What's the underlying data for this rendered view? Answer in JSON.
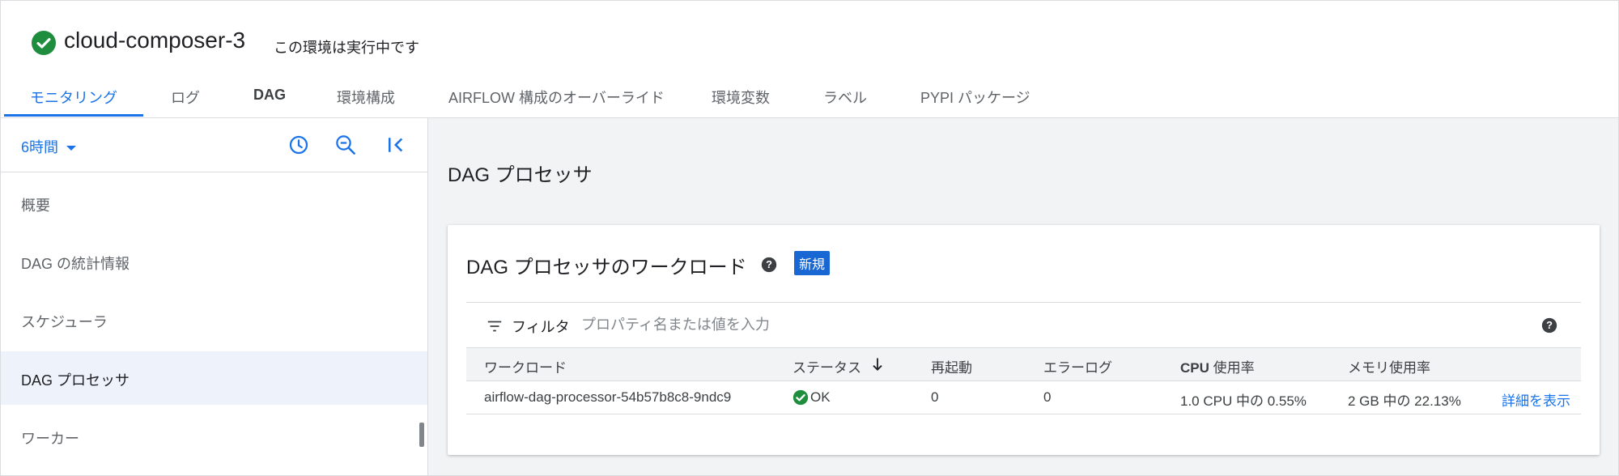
{
  "header": {
    "env_name": "cloud-composer-3",
    "env_status": "この環境は実行中です",
    "status_icon": "check-circle-icon",
    "accent": "#1e8e3e"
  },
  "tabs": [
    {
      "label": "モニタリング",
      "active": true
    },
    {
      "label": "ログ"
    },
    {
      "label": "DAG"
    },
    {
      "label": "環境構成"
    },
    {
      "label": "AIRFLOW 構成のオーバーライド"
    },
    {
      "label": "環境変数"
    },
    {
      "label": "ラベル"
    },
    {
      "label": "PYPI パッケージ"
    }
  ],
  "sidebar": {
    "time_range": "6時間",
    "toolbar_icons": [
      "clock-icon",
      "zoom-out-icon",
      "collapse-panel-icon"
    ],
    "items": [
      {
        "label": "概要"
      },
      {
        "label": "DAG の統計情報"
      },
      {
        "label": "スケジューラ"
      },
      {
        "label": "DAG プロセッサ",
        "active": true
      },
      {
        "label": "ワーカー"
      }
    ]
  },
  "main": {
    "title": "DAG プロセッサ",
    "card": {
      "title": "DAG プロセッサのワークロード",
      "badge": "新規",
      "filter_label": "フィルタ",
      "filter_placeholder": "プロパティ名または値を入力",
      "columns": [
        "ワークロード",
        "ステータス",
        "再起動",
        "エラーログ",
        "CPU",
        "使用率",
        "メモリ使用率"
      ],
      "rows": [
        {
          "workload": "airflow-dag-processor-54b57b8c8-9ndc9",
          "status": "OK",
          "restarts": "0",
          "error_logs": "0",
          "cpu": "1.0 CPU 中の 0.55%",
          "memory": "2 GB 中の 22.13%",
          "details": "詳細を表示"
        }
      ]
    }
  },
  "colors": {
    "link": "#1a73e8",
    "ok_green": "#1e8e3e",
    "badge": "#1967d2"
  }
}
